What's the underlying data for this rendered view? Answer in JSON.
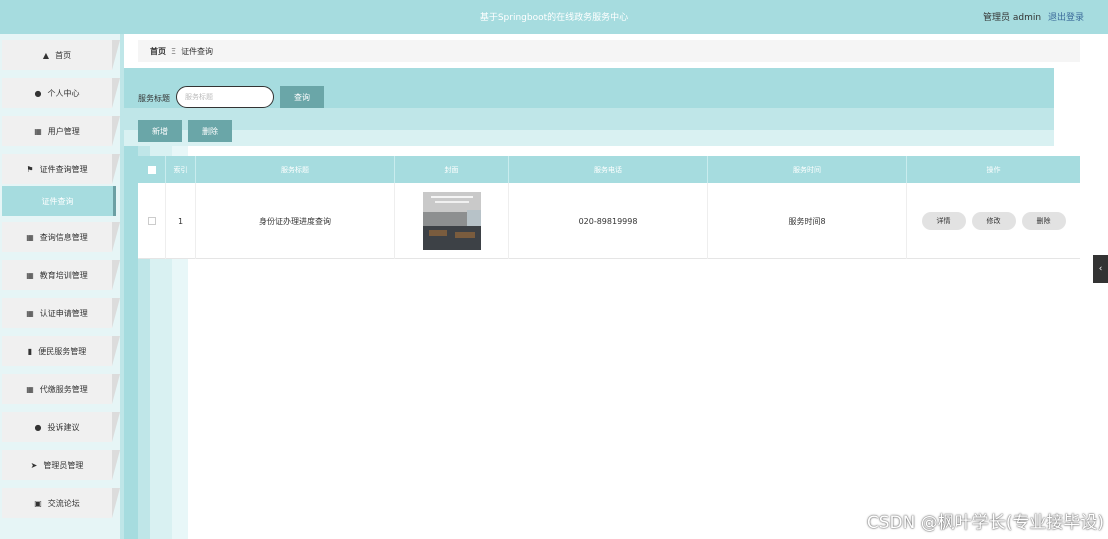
{
  "header": {
    "title": "基于Springboot的在线政务服务中心",
    "user_label": "管理员 admin",
    "logout": "退出登录",
    "bg_color": "#a6dcdf"
  },
  "sidebar": {
    "items": [
      {
        "label": "首页",
        "icon": "home-icon"
      },
      {
        "label": "个人中心",
        "icon": "user-icon"
      },
      {
        "label": "用户管理",
        "icon": "grid-icon"
      },
      {
        "label": "证件查询管理",
        "icon": "flag-icon"
      },
      {
        "label": "证件查询",
        "icon": ""
      },
      {
        "label": "查询信息管理",
        "icon": "grid-icon"
      },
      {
        "label": "教育培训管理",
        "icon": "grid-icon"
      },
      {
        "label": "认证申请管理",
        "icon": "grid-icon"
      },
      {
        "label": "便民服务管理",
        "icon": "bar-chart-icon"
      },
      {
        "label": "代缴服务管理",
        "icon": "grid-icon"
      },
      {
        "label": "投诉建议",
        "icon": "user-icon"
      },
      {
        "label": "管理员管理",
        "icon": "send-icon"
      },
      {
        "label": "交流论坛",
        "icon": "clipboard-icon"
      }
    ]
  },
  "breadcrumb": {
    "home": "首页",
    "separator": "Ξ",
    "current": "证件查询"
  },
  "search": {
    "label": "服务标题",
    "placeholder": "服务标题",
    "query_button": "查询"
  },
  "actions": {
    "add": "新增",
    "delete": "删除"
  },
  "table": {
    "columns": [
      "索引",
      "服务标题",
      "封面",
      "服务电话",
      "服务时间",
      "操作"
    ],
    "rows": [
      {
        "index": "1",
        "title": "身份证办理进度查询",
        "phone": "020-89819998",
        "time": "服务时间8",
        "ops": [
          "详情",
          "修改",
          "删除"
        ]
      }
    ]
  },
  "watermark": "CSDN @枫叶学长(专业接毕设)",
  "accent_color": "#6aa6a8"
}
